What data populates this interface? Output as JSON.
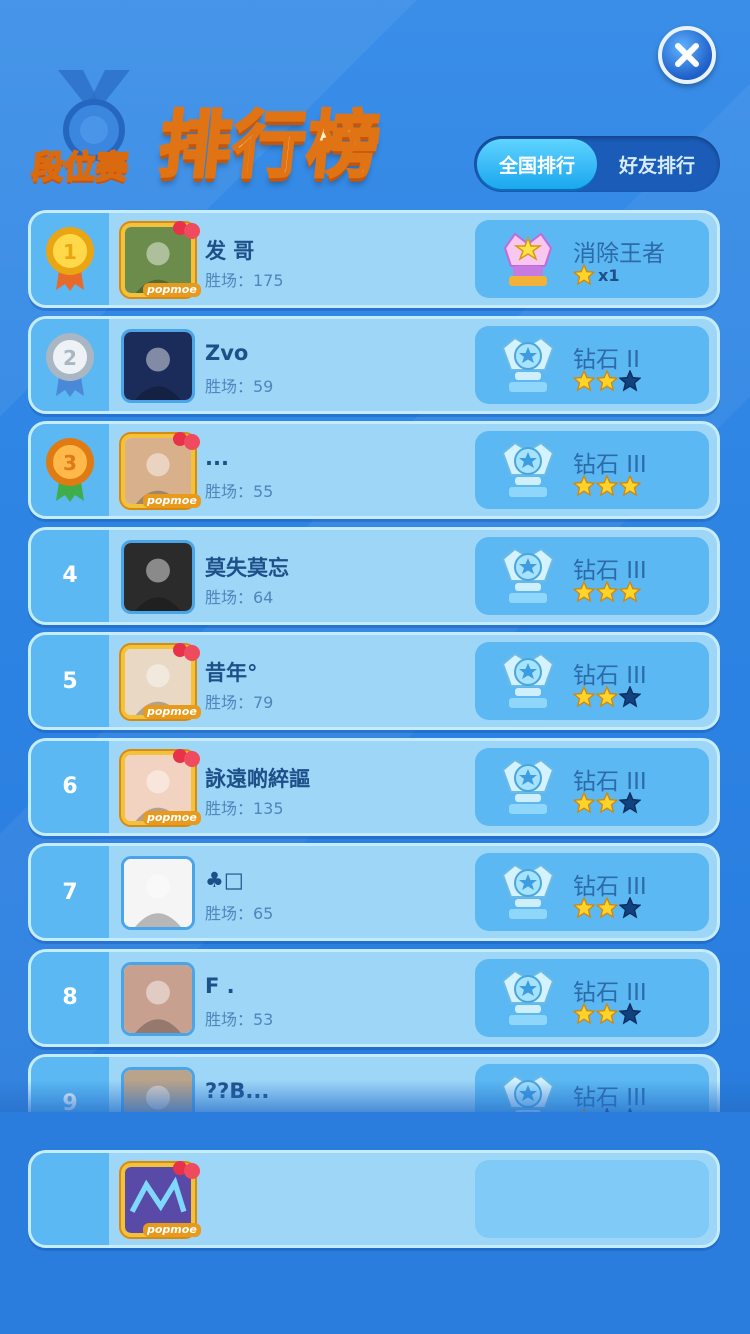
{
  "header": {
    "title_small": "段位赛",
    "title_big": "排行榜",
    "close_label": "✕"
  },
  "tabs": [
    {
      "label": "全国排行",
      "active": true
    },
    {
      "label": "好友排行",
      "active": false
    }
  ],
  "colors": {
    "accent": "#1ba7ef",
    "row_bg": "#9ed6f8",
    "rank_cell": "#5bb8f2",
    "gold": "#f4c13a"
  },
  "rows": [
    {
      "rank": "1",
      "medal": "gold-medal",
      "name": "发 哥",
      "wins": "胜场：175",
      "rank_title": "消除王者",
      "stars_filled": 1,
      "stars_total": 1,
      "star_count": "x1",
      "trophy": "king-trophy",
      "frame": "gold"
    },
    {
      "rank": "2",
      "medal": "silver-medal",
      "name": "Zvo",
      "wins": "胜场：59",
      "rank_title": "钻石 II",
      "stars_filled": 2,
      "stars_total": 3,
      "trophy": "diamond-trophy",
      "frame": "plain"
    },
    {
      "rank": "3",
      "medal": "bronze-medal",
      "name": "...",
      "wins": "胜场：55",
      "rank_title": "钻石 III",
      "stars_filled": 3,
      "stars_total": 3,
      "trophy": "diamond-trophy",
      "frame": "gold"
    },
    {
      "rank": "4",
      "name": "莫失莫忘",
      "wins": "胜场：64",
      "rank_title": "钻石 III",
      "stars_filled": 3,
      "stars_total": 3,
      "trophy": "diamond-trophy",
      "frame": "plain"
    },
    {
      "rank": "5",
      "name": "昔年°",
      "wins": "胜场：79",
      "rank_title": "钻石 III",
      "stars_filled": 2,
      "stars_total": 3,
      "trophy": "diamond-trophy",
      "frame": "gold"
    },
    {
      "rank": "6",
      "name": "詠遠啲綷謳",
      "wins": "胜场：135",
      "rank_title": "钻石 III",
      "stars_filled": 2,
      "stars_total": 3,
      "trophy": "diamond-trophy",
      "frame": "gold"
    },
    {
      "rank": "7",
      "name": "♣□",
      "wins": "胜场：65",
      "rank_title": "钻石 III",
      "stars_filled": 2,
      "stars_total": 3,
      "trophy": "diamond-trophy",
      "frame": "plain"
    },
    {
      "rank": "8",
      "name": "F .",
      "wins": "胜场：53",
      "rank_title": "钻石 III",
      "stars_filled": 2,
      "stars_total": 3,
      "trophy": "diamond-trophy",
      "frame": "plain"
    },
    {
      "rank": "9",
      "name": "??B...",
      "wins": "",
      "rank_title": "钻石 III",
      "stars_filled": 1,
      "stars_total": 3,
      "trophy": "diamond-trophy",
      "frame": "plain"
    }
  ],
  "popmoe_label": "popmoe",
  "my_row": {
    "rank": "",
    "name": "",
    "wins": "",
    "rank_title": "",
    "frame": "gold"
  }
}
